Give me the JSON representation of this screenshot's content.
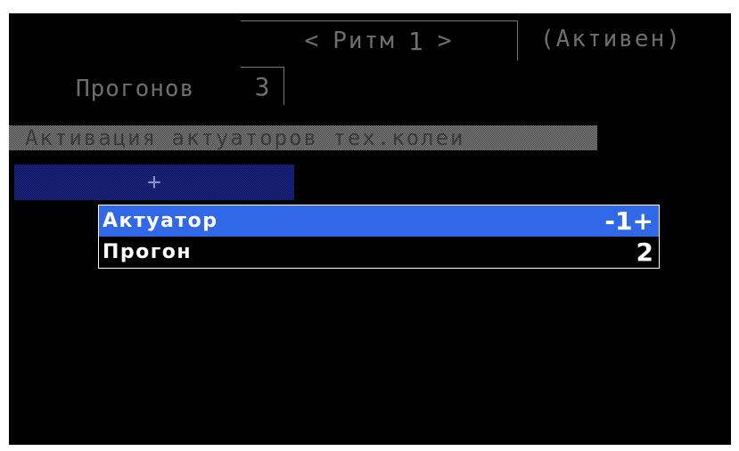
{
  "header": {
    "rhythm_prev": "<",
    "rhythm_label": "Ритм",
    "rhythm_number": "1",
    "rhythm_next": ">",
    "status": "(Активен)"
  },
  "runs": {
    "label": "Прогонов",
    "value": "3"
  },
  "section": {
    "title": "Активация актуаторов тех.колеи"
  },
  "add_button": {
    "label": "+"
  },
  "popup": {
    "rows": [
      {
        "label": "Актуатор",
        "value": "-1+"
      },
      {
        "label": "Прогон",
        "value": "2"
      }
    ]
  },
  "colors": {
    "background": "#000000",
    "selected_row": "#3168e8",
    "add_button": "#1e2a9c",
    "section_bar": "#8a8a8a"
  }
}
